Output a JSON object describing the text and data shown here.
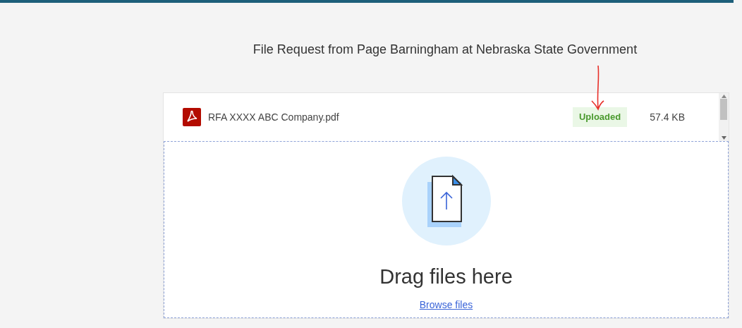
{
  "header": {
    "title": "File Request from Page Barningham at Nebraska State Government"
  },
  "files": [
    {
      "name": "RFA XXXX ABC Company.pdf",
      "status": "Uploaded",
      "size": "57.4 KB"
    }
  ],
  "dropzone": {
    "prompt": "Drag files here",
    "browse_link": "Browse files"
  }
}
